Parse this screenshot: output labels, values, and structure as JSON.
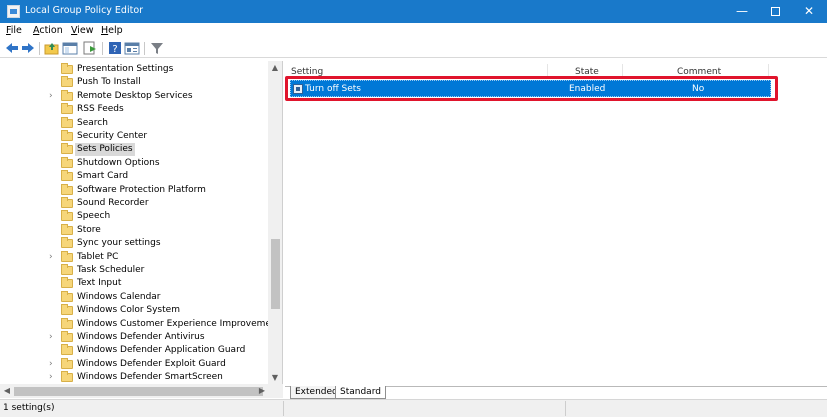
{
  "window": {
    "title": "Local Group Policy Editor",
    "title_bar_color": "#1979ca",
    "buttons": {
      "minimize": "—",
      "close": "✕"
    }
  },
  "menu": [
    "File",
    "Action",
    "View",
    "Help"
  ],
  "toolbar": [
    "back-icon",
    "forward-icon",
    "up-folder-icon",
    "show-hide-tree-icon",
    "export-list-icon",
    "help-icon",
    "properties-icon",
    "filter-icon"
  ],
  "tree": {
    "items": [
      {
        "label": "Presentation Settings",
        "expandable": false
      },
      {
        "label": "Push To Install",
        "expandable": false
      },
      {
        "label": "Remote Desktop Services",
        "expandable": true
      },
      {
        "label": "RSS Feeds",
        "expandable": false
      },
      {
        "label": "Search",
        "expandable": false
      },
      {
        "label": "Security Center",
        "expandable": false
      },
      {
        "label": "Sets Policies",
        "expandable": false,
        "selected": true
      },
      {
        "label": "Shutdown Options",
        "expandable": false
      },
      {
        "label": "Smart Card",
        "expandable": false
      },
      {
        "label": "Software Protection Platform",
        "expandable": false
      },
      {
        "label": "Sound Recorder",
        "expandable": false
      },
      {
        "label": "Speech",
        "expandable": false
      },
      {
        "label": "Store",
        "expandable": false
      },
      {
        "label": "Sync your settings",
        "expandable": false
      },
      {
        "label": "Tablet PC",
        "expandable": true
      },
      {
        "label": "Task Scheduler",
        "expandable": false
      },
      {
        "label": "Text Input",
        "expandable": false
      },
      {
        "label": "Windows Calendar",
        "expandable": false
      },
      {
        "label": "Windows Color System",
        "expandable": false
      },
      {
        "label": "Windows Customer Experience Improvement Pro",
        "expandable": false
      },
      {
        "label": "Windows Defender Antivirus",
        "expandable": true
      },
      {
        "label": "Windows Defender Application Guard",
        "expandable": false
      },
      {
        "label": "Windows Defender Exploit Guard",
        "expandable": true
      },
      {
        "label": "Windows Defender SmartScreen",
        "expandable": true
      }
    ]
  },
  "detail": {
    "columns": {
      "setting": "Setting",
      "state": "State",
      "comment": "Comment"
    },
    "rows": [
      {
        "setting": "Turn off Sets",
        "state": "Enabled",
        "comment": "No",
        "selected": true
      }
    ],
    "highlight_color": "#e0142c",
    "selection_color": "#0078d7"
  },
  "tabs": [
    "Extended",
    "Standard"
  ],
  "active_tab": "Standard",
  "status": {
    "text": "1 setting(s)"
  }
}
